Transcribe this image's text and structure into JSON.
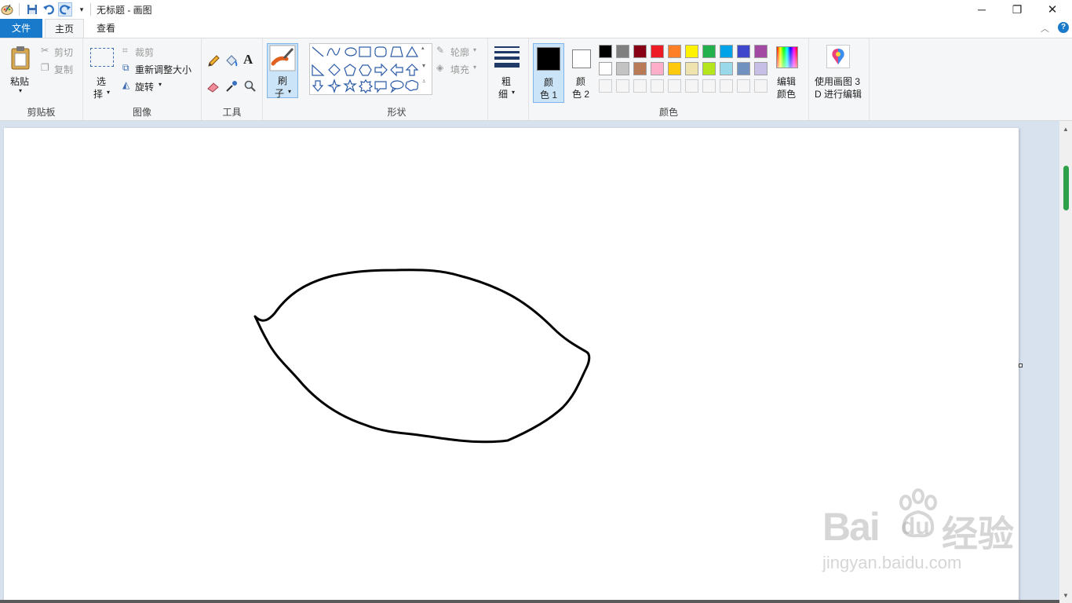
{
  "window": {
    "title": "无标题 - 画图",
    "controls": {
      "minimize": "─",
      "maximize": "❐",
      "close": "✕"
    }
  },
  "tabs": [
    {
      "label": "文件"
    },
    {
      "label": "主页"
    },
    {
      "label": "查看"
    }
  ],
  "ribbon": {
    "clipboard": {
      "paste": "粘贴",
      "cut": "剪切",
      "copy": "复制",
      "group_label": "剪贴板"
    },
    "image": {
      "select_1": "选",
      "select_2": "择",
      "crop": "裁剪",
      "resize": "重新调整大小",
      "rotate": "旋转",
      "group_label": "图像"
    },
    "tools": {
      "group_label": "工具",
      "text_tool": "A"
    },
    "brushes": {
      "label_1": "刷",
      "label_2": "子"
    },
    "shapes": {
      "outline": "轮廓",
      "fill": "填充",
      "group_label": "形状"
    },
    "size": {
      "label_1": "粗",
      "label_2": "细"
    },
    "colors": {
      "color1_a": "颜",
      "color1_b": "色 1",
      "color2_a": "颜",
      "color2_b": "色 2",
      "edit_a": "编辑",
      "edit_b": "颜色",
      "group_label": "颜色",
      "color1_value": "#000000",
      "color2_value": "#ffffff",
      "palette_row1": [
        "#000000",
        "#7f7f7f",
        "#880015",
        "#ed1c24",
        "#ff7f27",
        "#fff200",
        "#22b14c",
        "#00a2e8",
        "#3f48cc",
        "#a349a4"
      ],
      "palette_row2": [
        "#ffffff",
        "#c3c3c3",
        "#b97a57",
        "#ffaec9",
        "#ffc90e",
        "#efe4b0",
        "#b5e61d",
        "#99d9ea",
        "#7092be",
        "#c8bfe7"
      ],
      "palette_row3": [
        "#f5f5f5",
        "#f5f5f5",
        "#f5f5f5",
        "#f5f5f5",
        "#f5f5f5",
        "#f5f5f5",
        "#f5f5f5",
        "#f5f5f5",
        "#f5f5f5",
        "#f5f5f5"
      ]
    },
    "paint3d": {
      "label_1": "使用画图 3",
      "label_2": "D 进行编辑"
    }
  },
  "watermark": {
    "brand": "Bai",
    "brand2": "du",
    "jingyan": "经验",
    "url": "jingyan.baidu.com"
  }
}
